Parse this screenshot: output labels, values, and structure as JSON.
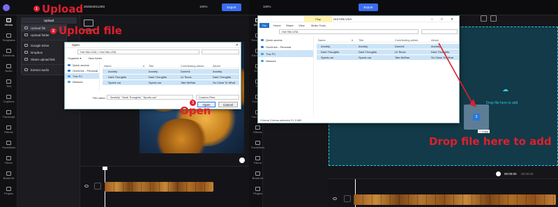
{
  "left": {
    "project_title": "20250401130S",
    "rail": [
      "Media",
      "Templates",
      "Elements",
      "Audio",
      "Text",
      "Captions",
      "Transcript",
      "Effects",
      "Transitions",
      "Filters",
      "Brand kit",
      "Plugins"
    ],
    "upload_tab": "Upload",
    "menu": {
      "upload_file": "Upload file",
      "upload_folder": "Upload folder",
      "google_drive": "Google Drive",
      "dropbox": "Dropbox",
      "share_link": "Share upload link",
      "extract_audio": "Extract audio"
    },
    "new_folder": "New folder",
    "zoom": "100%",
    "export": "Export",
    "annotations": {
      "step1_num": "1",
      "step1": "Upload",
      "step2_num": "2",
      "step2": "Upload file",
      "step3_num": "3",
      "step3": "Open"
    },
    "dialog": {
      "title": "Open",
      "path": "Hot Hits USA  >  Hot Hits USA",
      "organize": "Organize ▾",
      "new_folder": "New folder",
      "nav": [
        "Quick access",
        "OneDrive - Personal",
        "This PC",
        "Network"
      ],
      "headers": [
        "#",
        "Title",
        "Contributing artists",
        "Album"
      ],
      "files": [
        {
          "name": "Anxiety",
          "num": "",
          "title": "Anxiety",
          "artist": "Doechii",
          "album": "Anxiety"
        },
        {
          "name": "Dark Thoughts",
          "num": "",
          "title": "Dark Thoughts",
          "artist": "Lil Tecca",
          "album": "Dark Thoughts"
        },
        {
          "name": "Sports car",
          "num": "",
          "title": "Sports car",
          "artist": "Tate McRae",
          "album": "So Close To What"
        }
      ],
      "filename_label": "File name:",
      "filename_value": "\"Anxiety\" \"Dark Thoughts\" \"Sports car\"",
      "filetype": "Custom Files",
      "open": "Open",
      "cancel": "Cancel"
    },
    "timeline": {
      "time_a": "00:00:00",
      "time_b": "00:00"
    }
  },
  "right": {
    "zoom": "100%",
    "export": "Export",
    "rail": [
      "Media",
      "Templates",
      "Elements",
      "Audio",
      "Text",
      "Captions",
      "Transcript",
      "Effects",
      "Transitions",
      "Filters",
      "Brand kit",
      "Plugins"
    ],
    "explorer": {
      "title": "Hot Hits USA",
      "ribbon_tabs": [
        "File",
        "Home",
        "Share",
        "View",
        "Music Tools"
      ],
      "play_tab": "Play",
      "nav": [
        "Quick access",
        "OneDrive - Personal",
        "This PC",
        "Network"
      ],
      "headers": [
        "#",
        "Title",
        "Contributing artists",
        "Album"
      ],
      "files": [
        {
          "name": "Anxiety",
          "title": "Anxiety",
          "artist": "Doechii",
          "album": "Anxiety"
        },
        {
          "name": "Dark Thoughts",
          "title": "Dark Thoughts",
          "artist": "Lil Tecca",
          "album": "Dark Thoughts"
        },
        {
          "name": "Sports car",
          "title": "Sports car",
          "artist": "Tate McRae",
          "album": "So Close To What"
        }
      ],
      "status": "3 items   3 items selected  21.3 MB"
    },
    "drop_hint": "Drop file here to add",
    "copy_label": "+ Copy",
    "drag_count": "3",
    "annotation": "Drop file here to add",
    "timeline": {
      "time_a": "00:00:00",
      "time_b": "00:00:00"
    }
  },
  "colors": {
    "accent": "#3a6df0",
    "annotation": "#e01f2d",
    "drop_zone": "#123a48",
    "drop_text": "#2fc8e0"
  }
}
